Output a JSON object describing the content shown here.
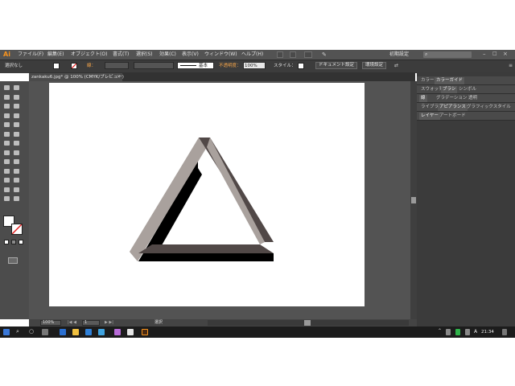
{
  "app": {
    "logo": "Ai"
  },
  "menu": {
    "items": [
      "ファイル(F)",
      "編集(E)",
      "オブジェクト(O)",
      "書式(T)",
      "選択(S)",
      "効果(C)",
      "表示(V)",
      "ウィンドウ(W)",
      "ヘルプ(H)"
    ],
    "workspace": "初期設定",
    "search_placeholder": ""
  },
  "control_bar": {
    "selection": "選択なし",
    "stroke_label": "線：",
    "stroke_style": "基本",
    "opacity_label": "不透明度：",
    "opacity_value": "100%",
    "style_label": "スタイル：",
    "doc_settings": "ドキュメント設定",
    "preferences": "環境設定"
  },
  "document": {
    "tab_title": "zankaku6.jpg* @ 100% (CMYK/プレビュー)",
    "close": "×"
  },
  "status_bar": {
    "zoom": "100%",
    "artboard": "1",
    "mode": "選択"
  },
  "panels": {
    "row1": [
      "カラー",
      "カラーガイド"
    ],
    "row2": [
      "スウォッチ",
      "ブラシ",
      "シンボル"
    ],
    "row3": [
      "線",
      "グラデーション",
      "透明"
    ],
    "row4": [
      "ライブラリ",
      "アピアランス",
      "グラフィックスタイル"
    ],
    "row5": [
      "レイヤー",
      "アートボード"
    ]
  },
  "taskbar": {
    "time": "21:34",
    "ime": "A"
  },
  "artwork": {
    "description_shape": "impossible-triangle",
    "colors": {
      "light": "#a9a19d",
      "dark": "#514847",
      "shadow": "#000000"
    }
  }
}
